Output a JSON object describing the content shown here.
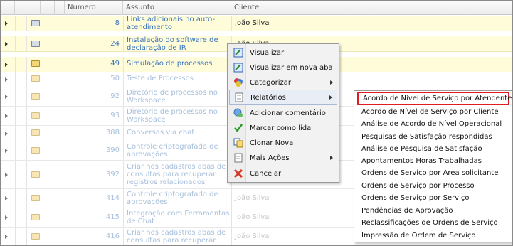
{
  "header": {
    "numero": "Número",
    "assunto": "Assunto",
    "cliente": "Cliente"
  },
  "rows": [
    {
      "num": "8",
      "subject": "Links adicionais no auto-atendimento",
      "client": "João Silva",
      "icon": "open-envelope-icon"
    },
    {
      "num": "24",
      "subject": "Instalação do software de declaração de IR",
      "client": "João Silva",
      "icon": "open-envelope-icon"
    },
    {
      "num": "49",
      "subject": "Simulação de processos",
      "client": "",
      "icon": "envelope-icon"
    },
    {
      "num": "50",
      "subject": "Teste de Processos",
      "client": "",
      "icon": "envelope-icon"
    },
    {
      "num": "92",
      "subject": "Diretório de processos no Workspace",
      "client": "",
      "icon": "envelope-icon"
    },
    {
      "num": "93",
      "subject": "Diretório de processos no Workspace",
      "client": "",
      "icon": "envelope-icon"
    },
    {
      "num": "388",
      "subject": "Conversas via chat",
      "client": "",
      "icon": "envelope-icon"
    },
    {
      "num": "390",
      "subject": "Controle criptografado de aprovações",
      "client": "",
      "icon": "envelope-icon"
    },
    {
      "num": "392",
      "subject": "Criar nos cadastros abas de consultas para recuperar registros relacionados",
      "client": "",
      "icon": "envelope-icon"
    },
    {
      "num": "414",
      "subject": "Controle criptografado de aprovações",
      "client": "João Silva",
      "icon": "envelope-icon"
    },
    {
      "num": "415",
      "subject": "Integração com Ferramentas de Chat",
      "client": "João Silva",
      "icon": "envelope-icon"
    },
    {
      "num": "416",
      "subject": "Criar nos cadastros abas de consultas para recuperar",
      "client": "João Silva",
      "icon": "envelope-icon"
    }
  ],
  "context_menu": {
    "items": [
      {
        "label": "Visualizar",
        "icon": "view-icon"
      },
      {
        "label": "Visualizar em nova aba",
        "icon": "new-tab-icon"
      },
      {
        "label": "Categorizar",
        "icon": "categorize-icon",
        "submenu": true
      },
      {
        "label": "Relatórios",
        "icon": "report-icon",
        "submenu": true,
        "selected": true
      },
      {
        "label": "Adicionar comentário",
        "icon": "comment-icon"
      },
      {
        "label": "Marcar como lida",
        "icon": "checkmark-icon"
      },
      {
        "label": "Clonar Nova",
        "icon": "clone-icon"
      },
      {
        "label": "Mais Ações",
        "icon": "more-actions-icon",
        "submenu": true
      },
      {
        "label": "Cancelar",
        "icon": "cancel-icon"
      }
    ]
  },
  "reports_submenu": {
    "items": [
      "Acordo de Nível de Serviço por Atendente",
      "Acordo de Nível de Serviço por Cliente",
      "Análise de Acordo de Nível Operacional",
      "Pesquisas de Satisfação respondidas",
      "Análise de Pesquisa de Satisfação",
      "Apontamentos Horas Trabalhadas",
      "Ordens de Serviço por Área solicitante",
      "Ordens de Serviço por Processo",
      "Ordens de Serviço por Serviço",
      "Pendências de Aprovação",
      "Reclassificações de Ordens de Serviço",
      "Impressão de Ordem de Serviço"
    ],
    "highlighted_index": 0
  },
  "colors": {
    "highlight_row": "#fefcd9",
    "link_blue": "#3a74bf",
    "annotation_red": "#e11b22"
  }
}
